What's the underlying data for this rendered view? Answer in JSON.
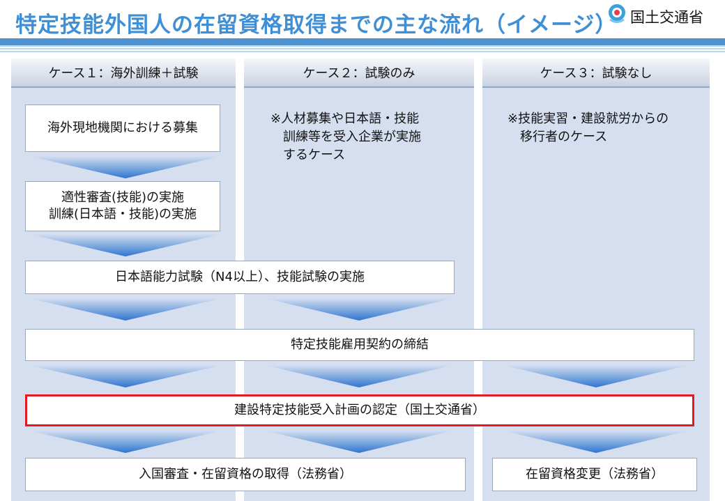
{
  "header": {
    "title": "特定技能外国人の在留資格取得までの主な流れ（イメージ）",
    "ministry": "国土交通省"
  },
  "columns": [
    {
      "label": "ケース１：海外訓練＋試験"
    },
    {
      "label": "ケース２：試験のみ"
    },
    {
      "label": "ケース３：試験なし"
    }
  ],
  "case2_note": [
    "※人材募集や日本語・技能",
    "訓練等を受入企業が実施",
    "するケース"
  ],
  "case3_note": [
    "※技能実習・建設就労からの",
    "移行者のケース"
  ],
  "steps": {
    "recruit": "海外現地機関における募集",
    "aptitude_1": "適性審査(技能)の実施",
    "aptitude_2": "訓練(日本語・技能)の実施",
    "exam": "日本語能力試験（N4以上）、技能試験の実施",
    "contract": "特定技能雇用契約の締結",
    "plan": "建設特定技能受入計画の認定（国土交通省）",
    "entry": "入国審査・在留資格の取得（法務省）",
    "change": "在留資格変更（法務省）"
  },
  "colors": {
    "title": "#3f8fd6",
    "column_bg": "#d5dff0",
    "arrow": "#2f74cf",
    "highlight_border": "#e01b24"
  }
}
